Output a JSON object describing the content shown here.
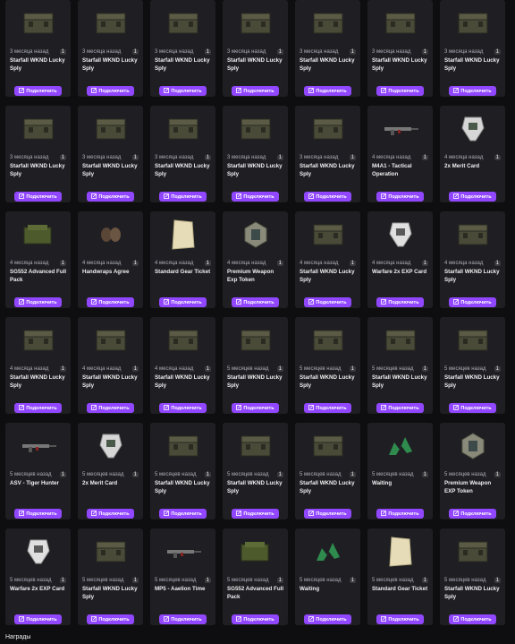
{
  "footer_label": "Награды",
  "cards": [
    {
      "time": "3 месяца назад",
      "title": "Starfall WKND Lucky Sply",
      "icon": "crate-icon",
      "count": "1",
      "button": "Подключить"
    },
    {
      "time": "3 месяца назад",
      "title": "Starfall WKND Lucky Sply",
      "icon": "crate-icon",
      "count": "1",
      "button": "Подключить"
    },
    {
      "time": "3 месяца назад",
      "title": "Starfall WKND Lucky Sply",
      "icon": "crate-icon",
      "count": "1",
      "button": "Подключить"
    },
    {
      "time": "3 месяца назад",
      "title": "Starfall WKND Lucky Sply",
      "icon": "crate-icon",
      "count": "1",
      "button": "Подключить"
    },
    {
      "time": "3 месяца назад",
      "title": "Starfall WKND Lucky Sply",
      "icon": "crate-icon",
      "count": "1",
      "button": "Подключить"
    },
    {
      "time": "3 месяца назад",
      "title": "Starfall WKND Lucky Sply",
      "icon": "crate-icon",
      "count": "1",
      "button": "Подключить"
    },
    {
      "time": "3 месяца назад",
      "title": "Starfall WKND Lucky Sply",
      "icon": "crate-icon",
      "count": "1",
      "button": "Подключить"
    },
    {
      "time": "3 месяца назад",
      "title": "Starfall WKND Lucky Sply",
      "icon": "crate-icon",
      "count": "1",
      "button": "Подключить"
    },
    {
      "time": "3 месяца назад",
      "title": "Starfall WKND Lucky Sply",
      "icon": "crate-icon",
      "count": "1",
      "button": "Подключить"
    },
    {
      "time": "3 месяца назад",
      "title": "Starfall WKND Lucky Sply",
      "icon": "crate-icon",
      "count": "1",
      "button": "Подключить"
    },
    {
      "time": "3 месяца назад",
      "title": "Starfall WKND Lucky Sply",
      "icon": "crate-icon",
      "count": "1",
      "button": "Подключить"
    },
    {
      "time": "3 месяца назад",
      "title": "Starfall WKND Lucky Sply",
      "icon": "crate-icon",
      "count": "1",
      "button": "Подключить"
    },
    {
      "time": "4 месяца назад",
      "title": "M4A1 - Tactical Operation",
      "icon": "rifle-icon",
      "count": "1",
      "button": "Подключить"
    },
    {
      "time": "4 месяца назад",
      "title": "2x Merit Card",
      "icon": "merit-card-icon",
      "count": "1",
      "button": "Подключить"
    },
    {
      "time": "4 месяца назад",
      "title": "SG552 Advanced Full Pack",
      "icon": "pack-icon",
      "count": "1",
      "button": "Подключить"
    },
    {
      "time": "4 месяца назад",
      "title": "Handwraps Agree",
      "icon": "handwraps-icon",
      "count": "1",
      "button": "Подключить"
    },
    {
      "time": "4 месяца назад",
      "title": "Standard Gear Ticket",
      "icon": "ticket-icon",
      "count": "1",
      "button": "Подключить"
    },
    {
      "time": "4 месяца назад",
      "title": "Premium Weapon Exp Token",
      "icon": "token-icon",
      "count": "1",
      "button": "Подключить"
    },
    {
      "time": "4 месяца назад",
      "title": "Starfall WKND Lucky Sply",
      "icon": "crate-icon",
      "count": "1",
      "button": "Подключить"
    },
    {
      "time": "4 месяца назад",
      "title": "Warfare 2x EXP Card",
      "icon": "exp-card-icon",
      "count": "1",
      "button": "Подключить"
    },
    {
      "time": "4 месяца назад",
      "title": "Starfall WKND Lucky Sply",
      "icon": "crate-icon",
      "count": "1",
      "button": "Подключить"
    },
    {
      "time": "4 месяца назад",
      "title": "Starfall WKND Lucky Sply",
      "icon": "crate-icon",
      "count": "1",
      "button": "Подключить"
    },
    {
      "time": "4 месяца назад",
      "title": "Starfall WKND Lucky Sply",
      "icon": "crate-icon",
      "count": "1",
      "button": "Подключить"
    },
    {
      "time": "4 месяца назад",
      "title": "Starfall WKND Lucky Sply",
      "icon": "crate-icon",
      "count": "1",
      "button": "Подключить"
    },
    {
      "time": "5 месяцев назад",
      "title": "Starfall WKND Lucky Sply",
      "icon": "crate-icon",
      "count": "1",
      "button": "Подключить"
    },
    {
      "time": "5 месяцев назад",
      "title": "Starfall WKND Lucky Sply",
      "icon": "crate-icon",
      "count": "1",
      "button": "Подключить"
    },
    {
      "time": "5 месяцев назад",
      "title": "Starfall WKND Lucky Sply",
      "icon": "crate-icon",
      "count": "1",
      "button": "Подключить"
    },
    {
      "time": "5 месяцев назад",
      "title": "Starfall WKND Lucky Sply",
      "icon": "crate-icon",
      "count": "1",
      "button": "Подключить"
    },
    {
      "time": "5 месяцев назад",
      "title": "ASV - Tiger Hunter",
      "icon": "rifle-icon",
      "count": "1",
      "button": "Подключить"
    },
    {
      "time": "5 месяцев назад",
      "title": "2x Merit Card",
      "icon": "merit-card-icon",
      "count": "1",
      "button": "Подключить"
    },
    {
      "time": "5 месяцев назад",
      "title": "Starfall WKND Lucky Sply",
      "icon": "crate-icon",
      "count": "1",
      "button": "Подключить"
    },
    {
      "time": "5 месяцев назад",
      "title": "Starfall WKND Lucky Sply",
      "icon": "crate-icon",
      "count": "1",
      "button": "Подключить"
    },
    {
      "time": "5 месяцев назад",
      "title": "Starfall WKND Lucky Sply",
      "icon": "crate-icon",
      "count": "1",
      "button": "Подключить"
    },
    {
      "time": "5 месяцев назад",
      "title": "Waiting",
      "icon": "dragon-icon",
      "count": "1",
      "button": "Подключить"
    },
    {
      "time": "5 месяцев назад",
      "title": "Premium Weapon EXP Token",
      "icon": "token-icon",
      "count": "1",
      "button": "Подключить"
    },
    {
      "time": "5 месяцев назад",
      "title": "Warfare 2x EXP Card",
      "icon": "exp-card-icon",
      "count": "1",
      "button": "Подключить"
    },
    {
      "time": "5 месяцев назад",
      "title": "Starfall WKND Lucky Sply",
      "icon": "crate-icon",
      "count": "1",
      "button": "Подключить"
    },
    {
      "time": "5 месяцев назад",
      "title": "MP5 - Aaelion Time",
      "icon": "rifle-icon",
      "count": "1",
      "button": "Подключить"
    },
    {
      "time": "5 месяцев назад",
      "title": "SG552 Advanced Full Pack",
      "icon": "pack-icon",
      "count": "1",
      "button": "Подключить"
    },
    {
      "time": "5 месяцев назад",
      "title": "Waiting",
      "icon": "dragon-icon",
      "count": "1",
      "button": "Подключить"
    },
    {
      "time": "5 месяцев назад",
      "title": "Standard Gear Ticket",
      "icon": "ticket-icon",
      "count": "1",
      "button": "Подключить"
    },
    {
      "time": "5 месяцев назад",
      "title": "Starfall WKND Lucky Sply",
      "icon": "crate-icon",
      "count": "1",
      "button": "Подключить"
    }
  ]
}
